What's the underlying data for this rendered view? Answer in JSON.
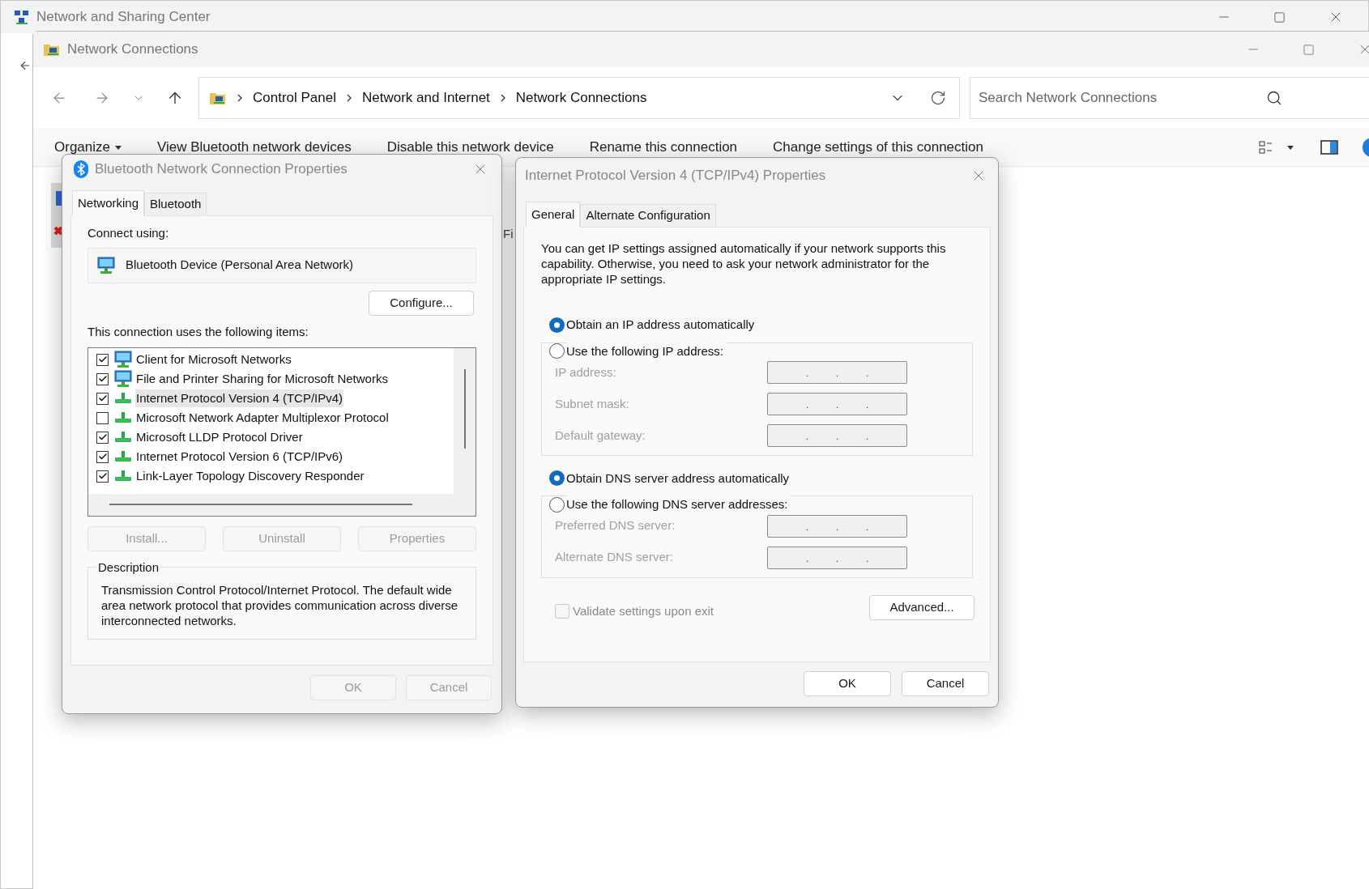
{
  "background_window": {
    "title": "Network and Sharing Center"
  },
  "explorer": {
    "title": "Network Connections",
    "breadcrumb": [
      "Control Panel",
      "Network and Internet",
      "Network Connections"
    ],
    "search": {
      "placeholder": "Search Network Connections"
    },
    "commands": [
      {
        "label": "Organize",
        "kind": "menu"
      },
      {
        "label": "View Bluetooth network devices",
        "kind": "plain"
      },
      {
        "label": "Disable this network device",
        "kind": "plain"
      },
      {
        "label": "Rename this connection",
        "kind": "plain"
      },
      {
        "label": "Change settings of this connection",
        "kind": "plain"
      }
    ],
    "content_fragment": "Fi"
  },
  "bluetooth_dialog": {
    "title": "Bluetooth Network Connection Properties",
    "tabs": [
      {
        "label": "Networking",
        "selected": true
      },
      {
        "label": "Bluetooth",
        "selected": false
      }
    ],
    "connect_using_label": "Connect using:",
    "device": "Bluetooth Device (Personal Area Network)",
    "configure_button": {
      "label": "Configure...",
      "disabled": false
    },
    "items_label": "This connection uses the following items:",
    "items": [
      {
        "label": "Client for Microsoft Networks",
        "kind": "computer",
        "checked": true,
        "selected": false
      },
      {
        "label": "File and Printer Sharing for Microsoft Networks",
        "kind": "computer",
        "checked": true,
        "selected": false
      },
      {
        "label": "Internet Protocol Version 4 (TCP/IPv4)",
        "kind": "protocol",
        "checked": true,
        "selected": true
      },
      {
        "label": "Microsoft Network Adapter Multiplexor Protocol",
        "kind": "protocol",
        "checked": false,
        "selected": false
      },
      {
        "label": "Microsoft LLDP Protocol Driver",
        "kind": "protocol",
        "checked": true,
        "selected": false
      },
      {
        "label": "Internet Protocol Version 6 (TCP/IPv6)",
        "kind": "protocol",
        "checked": true,
        "selected": false
      },
      {
        "label": "Link-Layer Topology Discovery Responder",
        "kind": "protocol",
        "checked": true,
        "selected": false
      }
    ],
    "item_buttons": [
      {
        "label": "Install...",
        "disabled": true
      },
      {
        "label": "Uninstall",
        "disabled": true
      },
      {
        "label": "Properties",
        "disabled": true
      }
    ],
    "description_title": "Description",
    "description": "Transmission Control Protocol/Internet Protocol. The default wide area network protocol that provides communication across diverse interconnected networks.",
    "buttons": [
      {
        "label": "OK",
        "disabled": true
      },
      {
        "label": "Cancel",
        "disabled": true
      }
    ]
  },
  "ipv4_dialog": {
    "title": "Internet Protocol Version 4 (TCP/IPv4) Properties",
    "tabs": [
      {
        "label": "General",
        "selected": true
      },
      {
        "label": "Alternate Configuration",
        "selected": false
      }
    ],
    "intro": "You can get IP settings assigned automatically if your network supports this capability. Otherwise, you need to ask your network administrator for the appropriate IP settings.",
    "ip_mode": [
      {
        "label": "Obtain an IP address automatically",
        "selected": true
      },
      {
        "label": "Use the following IP address:",
        "selected": false
      }
    ],
    "ip_fields": [
      {
        "label": "IP address:",
        "disabled": true,
        "dots": [
          ".",
          ".",
          "."
        ]
      },
      {
        "label": "Subnet mask:",
        "disabled": true,
        "dots": [
          ".",
          ".",
          "."
        ]
      },
      {
        "label": "Default gateway:",
        "disabled": true,
        "dots": [
          ".",
          ".",
          "."
        ]
      }
    ],
    "dns_mode": [
      {
        "label": "Obtain DNS server address automatically",
        "selected": true
      },
      {
        "label": "Use the following DNS server addresses:",
        "selected": false
      }
    ],
    "dns_fields": [
      {
        "label": "Preferred DNS server:",
        "disabled": true,
        "dots": [
          ".",
          ".",
          "."
        ]
      },
      {
        "label": "Alternate DNS server:",
        "disabled": true,
        "dots": [
          ".",
          ".",
          "."
        ]
      }
    ],
    "validate": {
      "label": "Validate settings upon exit",
      "checked": false,
      "disabled": true
    },
    "advanced_button": {
      "label": "Advanced...",
      "disabled": false
    },
    "buttons": [
      {
        "label": "OK",
        "disabled": false
      },
      {
        "label": "Cancel",
        "disabled": false
      }
    ]
  }
}
